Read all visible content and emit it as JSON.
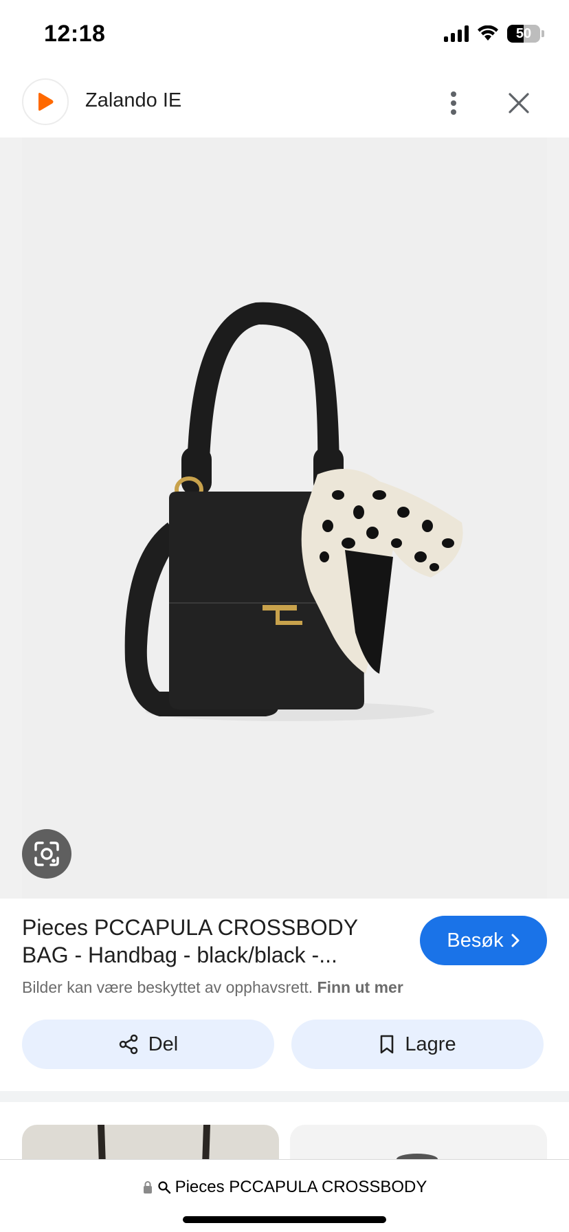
{
  "status_bar": {
    "time": "12:18",
    "battery_level": "50",
    "icons": [
      "signal-icon",
      "wifi-icon",
      "battery-icon"
    ]
  },
  "header": {
    "site_name": "Zalando IE",
    "logo_icon": "zalando-logo-icon",
    "more_icon": "more-vert-icon",
    "close_icon": "close-icon"
  },
  "image_viewer": {
    "product_image": "black handbag with leopard print scarf",
    "lens_icon": "google-lens-icon"
  },
  "product": {
    "title": "Pieces PCCAPULA CROSSBODY BAG - Handbag - black/black -...",
    "visit_label": "Besøk",
    "copyright_text": "Bilder kan være beskyttet av opphavsrett.",
    "learn_more_label": "Finn ut mer",
    "share_label": "Del",
    "save_label": "Lagre"
  },
  "url_bar": {
    "query": "Pieces PCCAPULA CROSSBODY"
  },
  "colors": {
    "accent": "#1a73e8",
    "chip_bg": "#e8f0fe",
    "image_bg": "#efefef",
    "brand": "#ff6900"
  }
}
